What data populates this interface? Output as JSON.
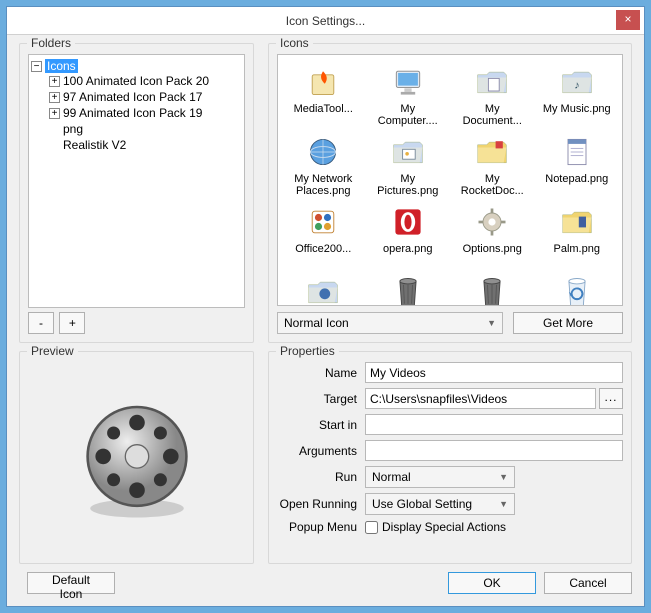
{
  "window": {
    "title": "Icon Settings...",
    "close": "×"
  },
  "folders": {
    "label": "Folders",
    "root": "Icons",
    "children": [
      "100 Animated Icon Pack  20",
      "97 Animated Icon Pack  17",
      "99 Animated Icon Pack  19",
      "png",
      "Realistik V2"
    ],
    "btn_remove": "-",
    "btn_add": "+"
  },
  "icons": {
    "label": "Icons",
    "items": [
      {
        "name": "mediatool",
        "label": "MediaTool...",
        "icon": "box-fire"
      },
      {
        "name": "mycomputer",
        "label": "My\nComputer....",
        "icon": "monitor"
      },
      {
        "name": "mydocuments",
        "label": "My\nDocument...",
        "icon": "folder-doc"
      },
      {
        "name": "mymusic",
        "label": "My Music.png",
        "icon": "folder-music"
      },
      {
        "name": "mynetwork",
        "label": "My Network\nPlaces.png",
        "icon": "globe"
      },
      {
        "name": "mypictures",
        "label": "My\nPictures.png",
        "icon": "folder-pic"
      },
      {
        "name": "rocketdock",
        "label": "My\nRocketDoc...",
        "icon": "folder-yellow"
      },
      {
        "name": "notepad",
        "label": "Notepad.png",
        "icon": "notepad"
      },
      {
        "name": "office",
        "label": "Office200...",
        "icon": "office"
      },
      {
        "name": "opera",
        "label": "opera.png",
        "icon": "opera"
      },
      {
        "name": "options",
        "label": "Options.png",
        "icon": "gear"
      },
      {
        "name": "palm",
        "label": "Palm.png",
        "icon": "folder-palm"
      },
      {
        "name": "pc",
        "label": "",
        "icon": "tool"
      },
      {
        "name": "trash1",
        "label": "",
        "icon": "trash"
      },
      {
        "name": "trash2",
        "label": "",
        "icon": "trash"
      },
      {
        "name": "trash3",
        "label": "",
        "icon": "trash-blue"
      }
    ],
    "combo": "Normal Icon",
    "get_more": "Get More"
  },
  "preview": {
    "label": "Preview"
  },
  "props": {
    "label": "Properties",
    "name_label": "Name",
    "name_value": "My Videos",
    "target_label": "Target",
    "target_value": "C:\\Users\\snapfiles\\Videos",
    "browse": "...",
    "startin_label": "Start in",
    "startin_value": "",
    "args_label": "Arguments",
    "args_value": "",
    "run_label": "Run",
    "run_value": "Normal",
    "open_label": "Open Running",
    "open_value": "Use Global Setting",
    "popup_label": "Popup Menu",
    "popup_check": "Display Special Actions"
  },
  "footer": {
    "default_icon": "Default Icon",
    "ok": "OK",
    "cancel": "Cancel"
  }
}
